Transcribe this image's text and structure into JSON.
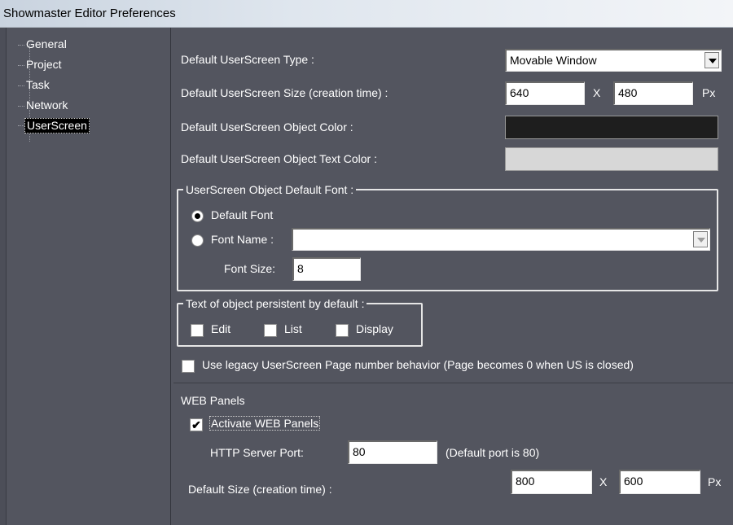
{
  "window": {
    "title": "Showmaster Editor Preferences"
  },
  "tree": {
    "items": [
      {
        "label": "General",
        "selected": false
      },
      {
        "label": "Project",
        "selected": false
      },
      {
        "label": "Task",
        "selected": false
      },
      {
        "label": "Network",
        "selected": false
      },
      {
        "label": "UserScreen",
        "selected": true
      }
    ]
  },
  "userscreen": {
    "type_label": "Default UserScreen Type :",
    "type_value": "Movable Window",
    "size_label": "Default UserScreen Size (creation time) :",
    "width_value": "640",
    "x_sep": "X",
    "height_value": "480",
    "unit": "Px",
    "object_color_label": "Default UserScreen Object Color :",
    "object_color": "#1e1e1e",
    "object_text_color_label": "Default UserScreen Object Text Color :",
    "object_text_color": "#d7d7d7"
  },
  "font_group": {
    "legend": "UserScreen Object Default Font :",
    "default_font_label": "Default Font",
    "default_font_selected": true,
    "font_name_label": "Font Name :",
    "font_name_value": "",
    "font_size_label": "Font Size:",
    "font_size_value": "8"
  },
  "persist_group": {
    "legend": "Text of object persistent by default :",
    "edit_label": "Edit",
    "edit_checked": false,
    "list_label": "List",
    "list_checked": false,
    "display_label": "Display",
    "display_checked": false
  },
  "legacy": {
    "label": "Use legacy UserScreen Page number behavior (Page becomes 0 when US is closed)",
    "checked": false
  },
  "web": {
    "section_label": "WEB Panels",
    "activate_label": "Activate WEB Panels",
    "activate_checked": true,
    "port_label": "HTTP Server Port:",
    "port_value": "80",
    "port_hint": "(Default port is 80)",
    "size_label": "Default Size (creation time) :",
    "width_value": "800",
    "x_sep": "X",
    "height_value": "600",
    "unit": "Px"
  }
}
